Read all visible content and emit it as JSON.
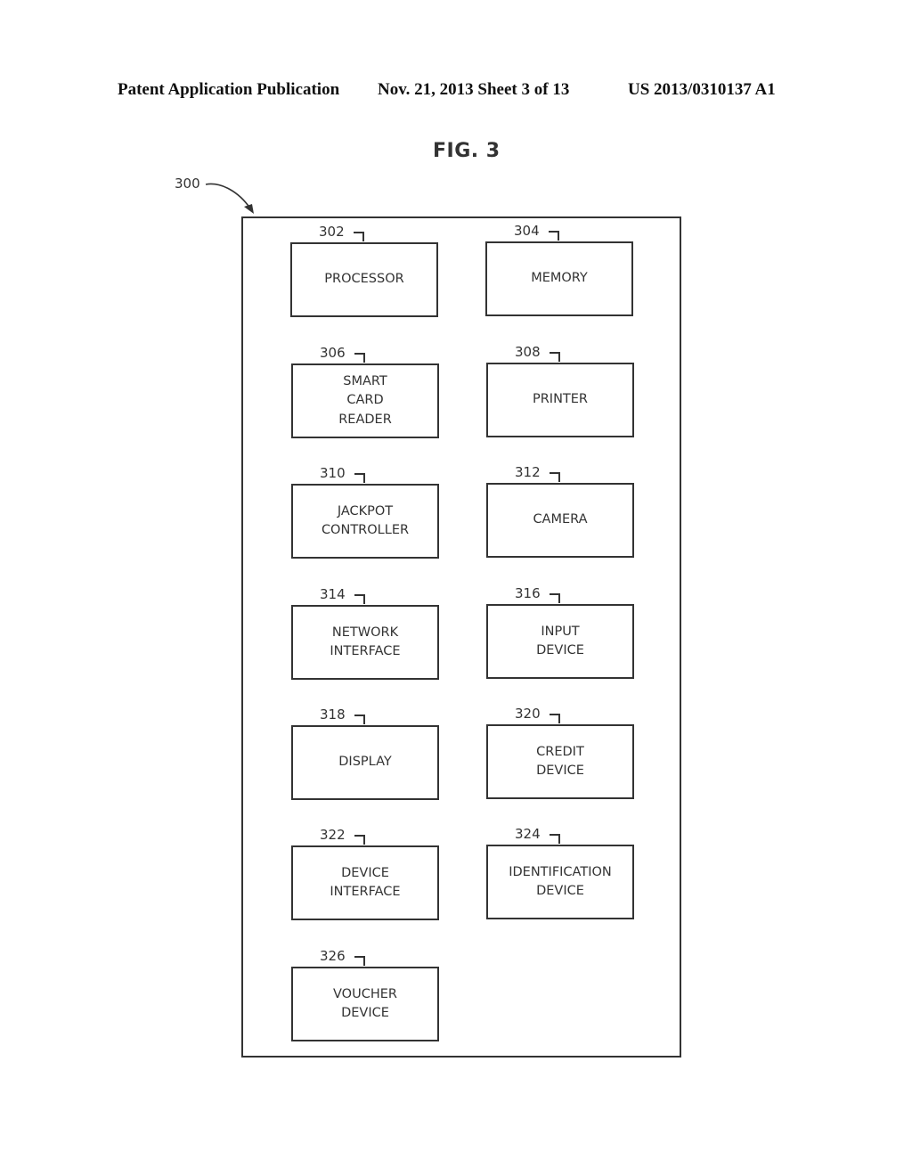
{
  "header": {
    "left": "Patent Application Publication",
    "middle": "Nov. 21, 2013   Sheet 3 of 13",
    "right": "US 2013/0310137 A1"
  },
  "figure": {
    "title": "FIG. 3",
    "ref": "300"
  },
  "blocks": [
    {
      "ref": "302",
      "label": "PROCESSOR"
    },
    {
      "ref": "304",
      "label": "MEMORY"
    },
    {
      "ref": "306",
      "label": "SMART\nCARD\nREADER"
    },
    {
      "ref": "308",
      "label": "PRINTER"
    },
    {
      "ref": "310",
      "label": "JACKPOT\nCONTROLLER"
    },
    {
      "ref": "312",
      "label": "CAMERA"
    },
    {
      "ref": "314",
      "label": "NETWORK\nINTERFACE"
    },
    {
      "ref": "316",
      "label": "INPUT\nDEVICE"
    },
    {
      "ref": "318",
      "label": "DISPLAY"
    },
    {
      "ref": "320",
      "label": "CREDIT\nDEVICE"
    },
    {
      "ref": "322",
      "label": "DEVICE\nINTERFACE"
    },
    {
      "ref": "324",
      "label": "IDENTIFICATION\nDEVICE"
    },
    {
      "ref": "326",
      "label": "VOUCHER\nDEVICE"
    }
  ]
}
